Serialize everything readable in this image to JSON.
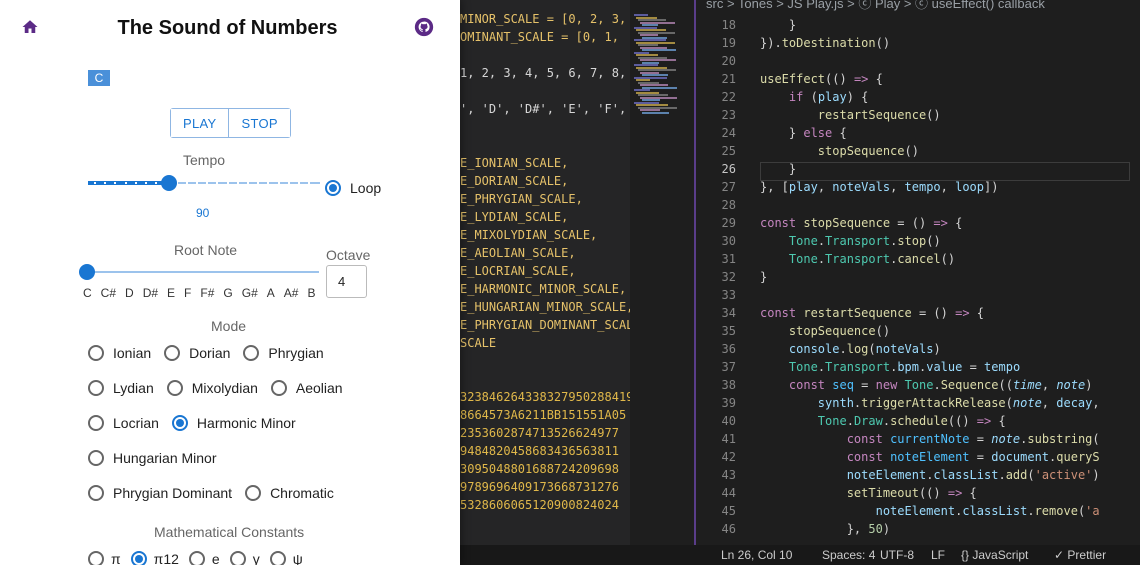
{
  "app": {
    "title": "The Sound of Numbers",
    "note_chip": "C",
    "play_label": "PLAY",
    "stop_label": "STOP",
    "tempo_label": "Tempo",
    "tempo_value": "90",
    "tempo_fraction": 0.35,
    "loop_label": "Loop",
    "loop_checked": true,
    "root_label": "Root Note",
    "root_index": 0,
    "octave_label": "Octave",
    "octave_value": "4",
    "notes": [
      "C",
      "C#",
      "D",
      "D#",
      "E",
      "F",
      "F#",
      "G",
      "G#",
      "A",
      "A#",
      "B"
    ],
    "mode_label": "Mode",
    "mode_rows": [
      [
        "Ionian",
        "Dorian",
        "Phrygian"
      ],
      [
        "Lydian",
        "Mixolydian",
        "Aeolian"
      ],
      [
        "Locrian",
        "Harmonic Minor"
      ],
      [
        "Hungarian Minor"
      ],
      [
        "Phrygian Dominant",
        "Chromatic"
      ]
    ],
    "selected_mode": "Harmonic Minor",
    "constants_label": "Mathematical Constants",
    "constants": [
      "π",
      "π12",
      "e",
      "γ",
      "ψ"
    ],
    "selected_constant": "π12",
    "accent_color": "#1976d2",
    "icons": {
      "home": "home-icon",
      "github": "github-icon"
    }
  },
  "mid_code": {
    "lines": [
      "MINOR_SCALE = [0, 2, 3,",
      "OMINANT_SCALE = [0, 1,",
      "",
      "1, 2, 3, 4, 5, 6, 7, 8,",
      "",
      "', 'D', 'D#', 'E', 'F',",
      "",
      "",
      "E_IONIAN_SCALE,",
      "E_DORIAN_SCALE,",
      "E_PHRYGIAN_SCALE,",
      "E_LYDIAN_SCALE,",
      "E_MIXOLYDIAN_SCALE,",
      "E_AEOLIAN_SCALE,",
      "E_LOCRIAN_SCALE,",
      "E_HARMONIC_MINOR_SCALE,",
      "E_HUNGARIAN_MINOR_SCALE,",
      "E_PHRYGIAN_DOMINANT_SCAL",
      "SCALE",
      "",
      "",
      "323846264338327950288419",
      "8664573A6211BB151551A05",
      "2353602874713526624977",
      "9484820458683436563811",
      "3095048801688724209698",
      "9789696409173668731276",
      "5328606065120900824024"
    ]
  },
  "editor": {
    "breadcrumb": "src > Tones > JS Play.js > ⓒ Play > ⓒ useEffect() callback",
    "first_line": 18,
    "current_line": 26
  },
  "statusbar": {
    "position": "Ln 26, Col 10",
    "spaces": "Spaces: 4",
    "encoding": "UTF-8",
    "eol": "LF",
    "language": "{} JavaScript",
    "prettier": "✓ Prettier"
  }
}
